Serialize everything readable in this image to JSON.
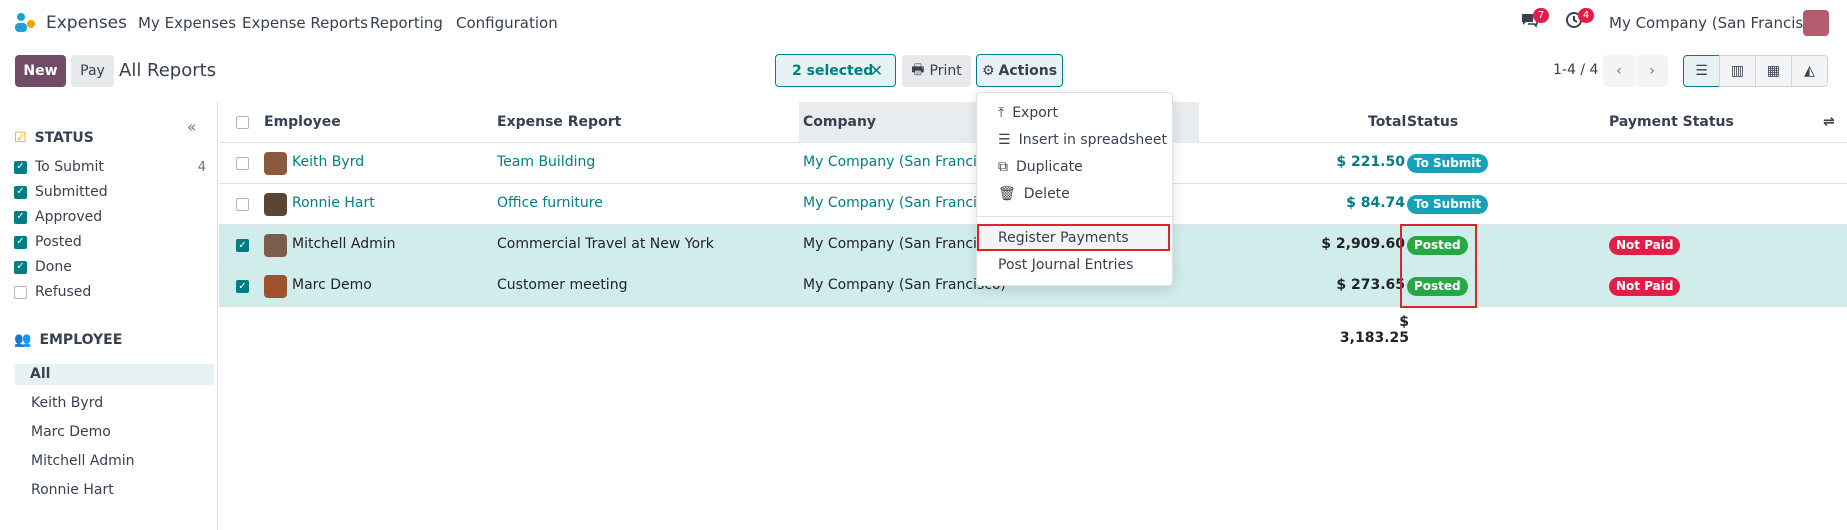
{
  "nav": {
    "app_name": "Expenses",
    "items": [
      "My Expenses",
      "Expense Reports",
      "Reporting",
      "Configuration"
    ],
    "chat_badge": "7",
    "activity_badge": "4",
    "company": "My Company (San Francisco)"
  },
  "control": {
    "new_label": "New",
    "pay_label": "Pay",
    "breadcrumb": "All Reports",
    "selected_label": "2 selected",
    "print_label": "Print",
    "actions_label": "Actions",
    "pager": "1-4 / 4"
  },
  "sidebar": {
    "status_title": "STATUS",
    "status_filters": [
      {
        "label": "To Submit",
        "checked": true,
        "count": "4"
      },
      {
        "label": "Submitted",
        "checked": true,
        "count": ""
      },
      {
        "label": "Approved",
        "checked": true,
        "count": ""
      },
      {
        "label": "Posted",
        "checked": true,
        "count": ""
      },
      {
        "label": "Done",
        "checked": true,
        "count": ""
      },
      {
        "label": "Refused",
        "checked": false,
        "count": ""
      }
    ],
    "employee_title": "EMPLOYEE",
    "employees": [
      "All",
      "Keith Byrd",
      "Marc Demo",
      "Mitchell Admin",
      "Ronnie Hart"
    ]
  },
  "table": {
    "headers": {
      "employee": "Employee",
      "report": "Expense Report",
      "company": "Company",
      "total": "Total",
      "status": "Status",
      "payment_status": "Payment Status"
    },
    "rows": [
      {
        "employee": "Keith Byrd",
        "report": "Team Building",
        "company": "My Company (San Francisco",
        "total": "$ 221.50",
        "status": "To Submit",
        "payment": "",
        "selected": false
      },
      {
        "employee": "Ronnie Hart",
        "report": "Office furniture",
        "company": "My Company (San Francisco",
        "total": "$ 84.74",
        "status": "To Submit",
        "payment": "",
        "selected": false
      },
      {
        "employee": "Mitchell Admin",
        "report": "Commercial Travel at New York",
        "company": "My Company (San Francisco",
        "total": "$ 2,909.60",
        "status": "Posted",
        "payment": "Not Paid",
        "selected": true
      },
      {
        "employee": "Marc Demo",
        "report": "Customer meeting",
        "company": "My Company (San Francisco)",
        "total": "$ 273.65",
        "status": "Posted",
        "payment": "Not Paid",
        "selected": true
      }
    ],
    "sum_total": "$ 3,183.25"
  },
  "actions_menu": {
    "items": [
      "Export",
      "Insert in spreadsheet",
      "Duplicate",
      "Delete"
    ],
    "extra": [
      "Register Payments",
      "Post Journal Entries"
    ]
  },
  "colors": {
    "brand": "#714b67",
    "accent": "#017e84",
    "posted": "#28a745",
    "to_submit": "#17a2b8",
    "not_paid": "#e11d48",
    "highlight": "#dc2626"
  }
}
